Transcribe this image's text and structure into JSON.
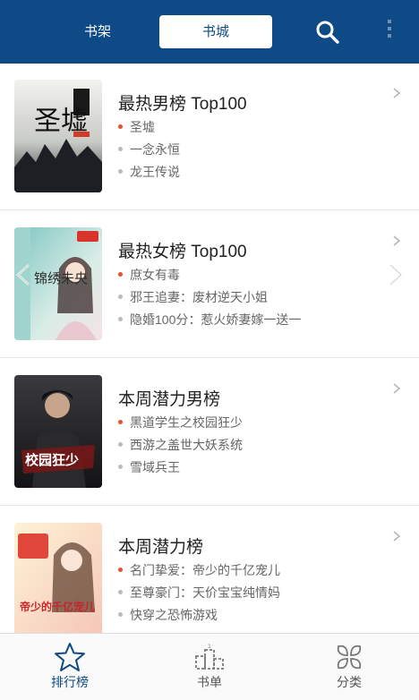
{
  "header": {
    "tab_shelf": "书架",
    "tab_store": "书城",
    "search_icon": "search-icon",
    "more_icon": "more-vertical-icon"
  },
  "rankings": [
    {
      "title": "最热男榜 Top100",
      "items": [
        "圣墟",
        "一念永恒",
        "龙王传说"
      ],
      "cover_text": "圣墟"
    },
    {
      "title": "最热女榜 Top100",
      "items": [
        "庶女有毒",
        "邪王追妻：废材逆天小姐",
        "隐婚100分：惹火娇妻嫁一送一"
      ],
      "cover_text": "锦绣未央"
    },
    {
      "title": "本周潜力男榜",
      "items": [
        "黑道学生之校园狂少",
        "西游之盖世大妖系统",
        "雪域兵王"
      ],
      "cover_text": "校园狂少"
    },
    {
      "title": "本周潜力榜",
      "items": [
        "名门挚爱：帝少的千亿宠儿",
        "至尊豪门：天价宝宝纯情妈",
        "快穿之恐怖游戏"
      ],
      "cover_text": "帝少的千亿宠儿"
    }
  ],
  "bottom_nav": {
    "ranking": "排行榜",
    "booklist": "书单",
    "category": "分类"
  },
  "colors": {
    "brand": "#0e4a86",
    "accent_dot": "#e8502e"
  }
}
